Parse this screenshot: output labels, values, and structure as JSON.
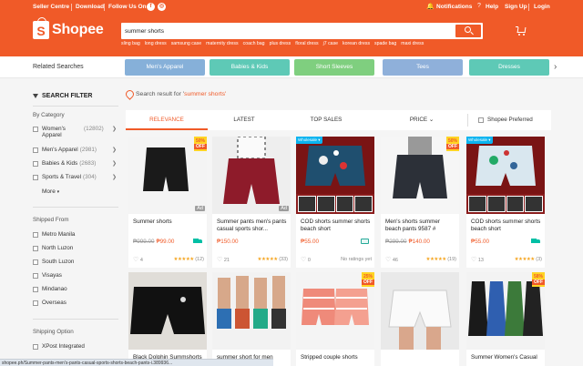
{
  "topbar": {
    "seller_centre": "Seller Centre",
    "download": "Download",
    "follow_us": "Follow Us On",
    "notifications": "Notifications",
    "help": "Help",
    "sign_up": "Sign Up",
    "login": "Login"
  },
  "logo": {
    "text": "Shopee",
    "bag_letter": "S"
  },
  "search": {
    "value": "summer shorts",
    "suggestions": [
      "sling bag",
      "long dress",
      "samsung case",
      "maternity dress",
      "coach bag",
      "plus dress",
      "floral dress",
      "j7 case",
      "korean dress",
      "spade bag",
      "maxi dress"
    ]
  },
  "related": {
    "title": "Related Searches",
    "pills": [
      {
        "label": "Men's Apparel",
        "color": "#86b0d9"
      },
      {
        "label": "Babies & Kids",
        "color": "#5ec9b6"
      },
      {
        "label": "Short Sleeves",
        "color": "#7fcf7f"
      },
      {
        "label": "Tees",
        "color": "#8fb0da"
      },
      {
        "label": "Dresses",
        "color": "#5ec9b6"
      }
    ]
  },
  "filter": {
    "title": "SEARCH FILTER",
    "by_category": "By Category",
    "categories": [
      {
        "label": "Women's Apparel",
        "count": "(12802)"
      },
      {
        "label": "Men's Apparel",
        "count": "(2981)"
      },
      {
        "label": "Babies & Kids",
        "count": "(2683)"
      },
      {
        "label": "Sports & Travel",
        "count": "(304)"
      }
    ],
    "more": "More",
    "shipped_from": "Shipped From",
    "locations": [
      "Metro Manila",
      "North Luzon",
      "South Luzon",
      "Visayas",
      "Mindanao",
      "Overseas"
    ],
    "shipping_option": "Shipping Option",
    "shipping": [
      "XPost Integrated"
    ]
  },
  "results": {
    "prefix": "Search result for '",
    "keyword": "summer shorts",
    "suffix": "'"
  },
  "sort": {
    "tabs": [
      "RELEVANCE",
      "LATEST",
      "TOP SALES",
      "PRICE"
    ],
    "preferred": "Shopee Preferred"
  },
  "products": [
    {
      "name": "Summer shorts",
      "old_price": "₱999.00",
      "price": "₱99.00",
      "likes": "4",
      "rating_count": "(12)",
      "stars": "★★★★★",
      "off": "50%",
      "badge": "OFF",
      "ad": "Ad"
    },
    {
      "name": "Summer pants men's pants casual sports shor...",
      "old_price": "",
      "price": "₱150.00",
      "likes": "21",
      "rating_count": "(33)",
      "stars": "★★★★★",
      "ad": "Ad"
    },
    {
      "name": "COD shorts summer shorts beach short",
      "old_price": "",
      "price": "₱55.00",
      "likes": "0",
      "no_ratings": "No ratings yet",
      "wholesale": "Wholesale ▾"
    },
    {
      "name": "Men's shorts summer beach pants 9587 #",
      "old_price": "₱299.00",
      "price": "₱140.00",
      "likes": "46",
      "rating_count": "(19)",
      "stars": "★★★★★",
      "off": "50%",
      "badge": "OFF"
    },
    {
      "name": "COD shorts summer shorts beach short",
      "old_price": "",
      "price": "₱55.00",
      "likes": "13",
      "rating_count": "(3)",
      "stars": "★★★★★",
      "wholesale": "Wholesale ▾"
    },
    {
      "name": "Black Dolphin Summshorts",
      "old_price": "",
      "price": ""
    },
    {
      "name": "summer short for men",
      "old_price": "",
      "price": ""
    },
    {
      "name": "Stripped couple shorts",
      "old_price": "",
      "price": "",
      "off": "25%",
      "badge": "OFF"
    },
    {
      "name": "",
      "old_price": "",
      "price": ""
    },
    {
      "name": "Summer Women's Casual",
      "old_price": "",
      "price": "",
      "off": "58%",
      "badge": "OFF"
    }
  ],
  "status_url": "shopee.ph/Summer-pants-men's-pants-casual-sports-shorts-beach-pants-i.389936..."
}
